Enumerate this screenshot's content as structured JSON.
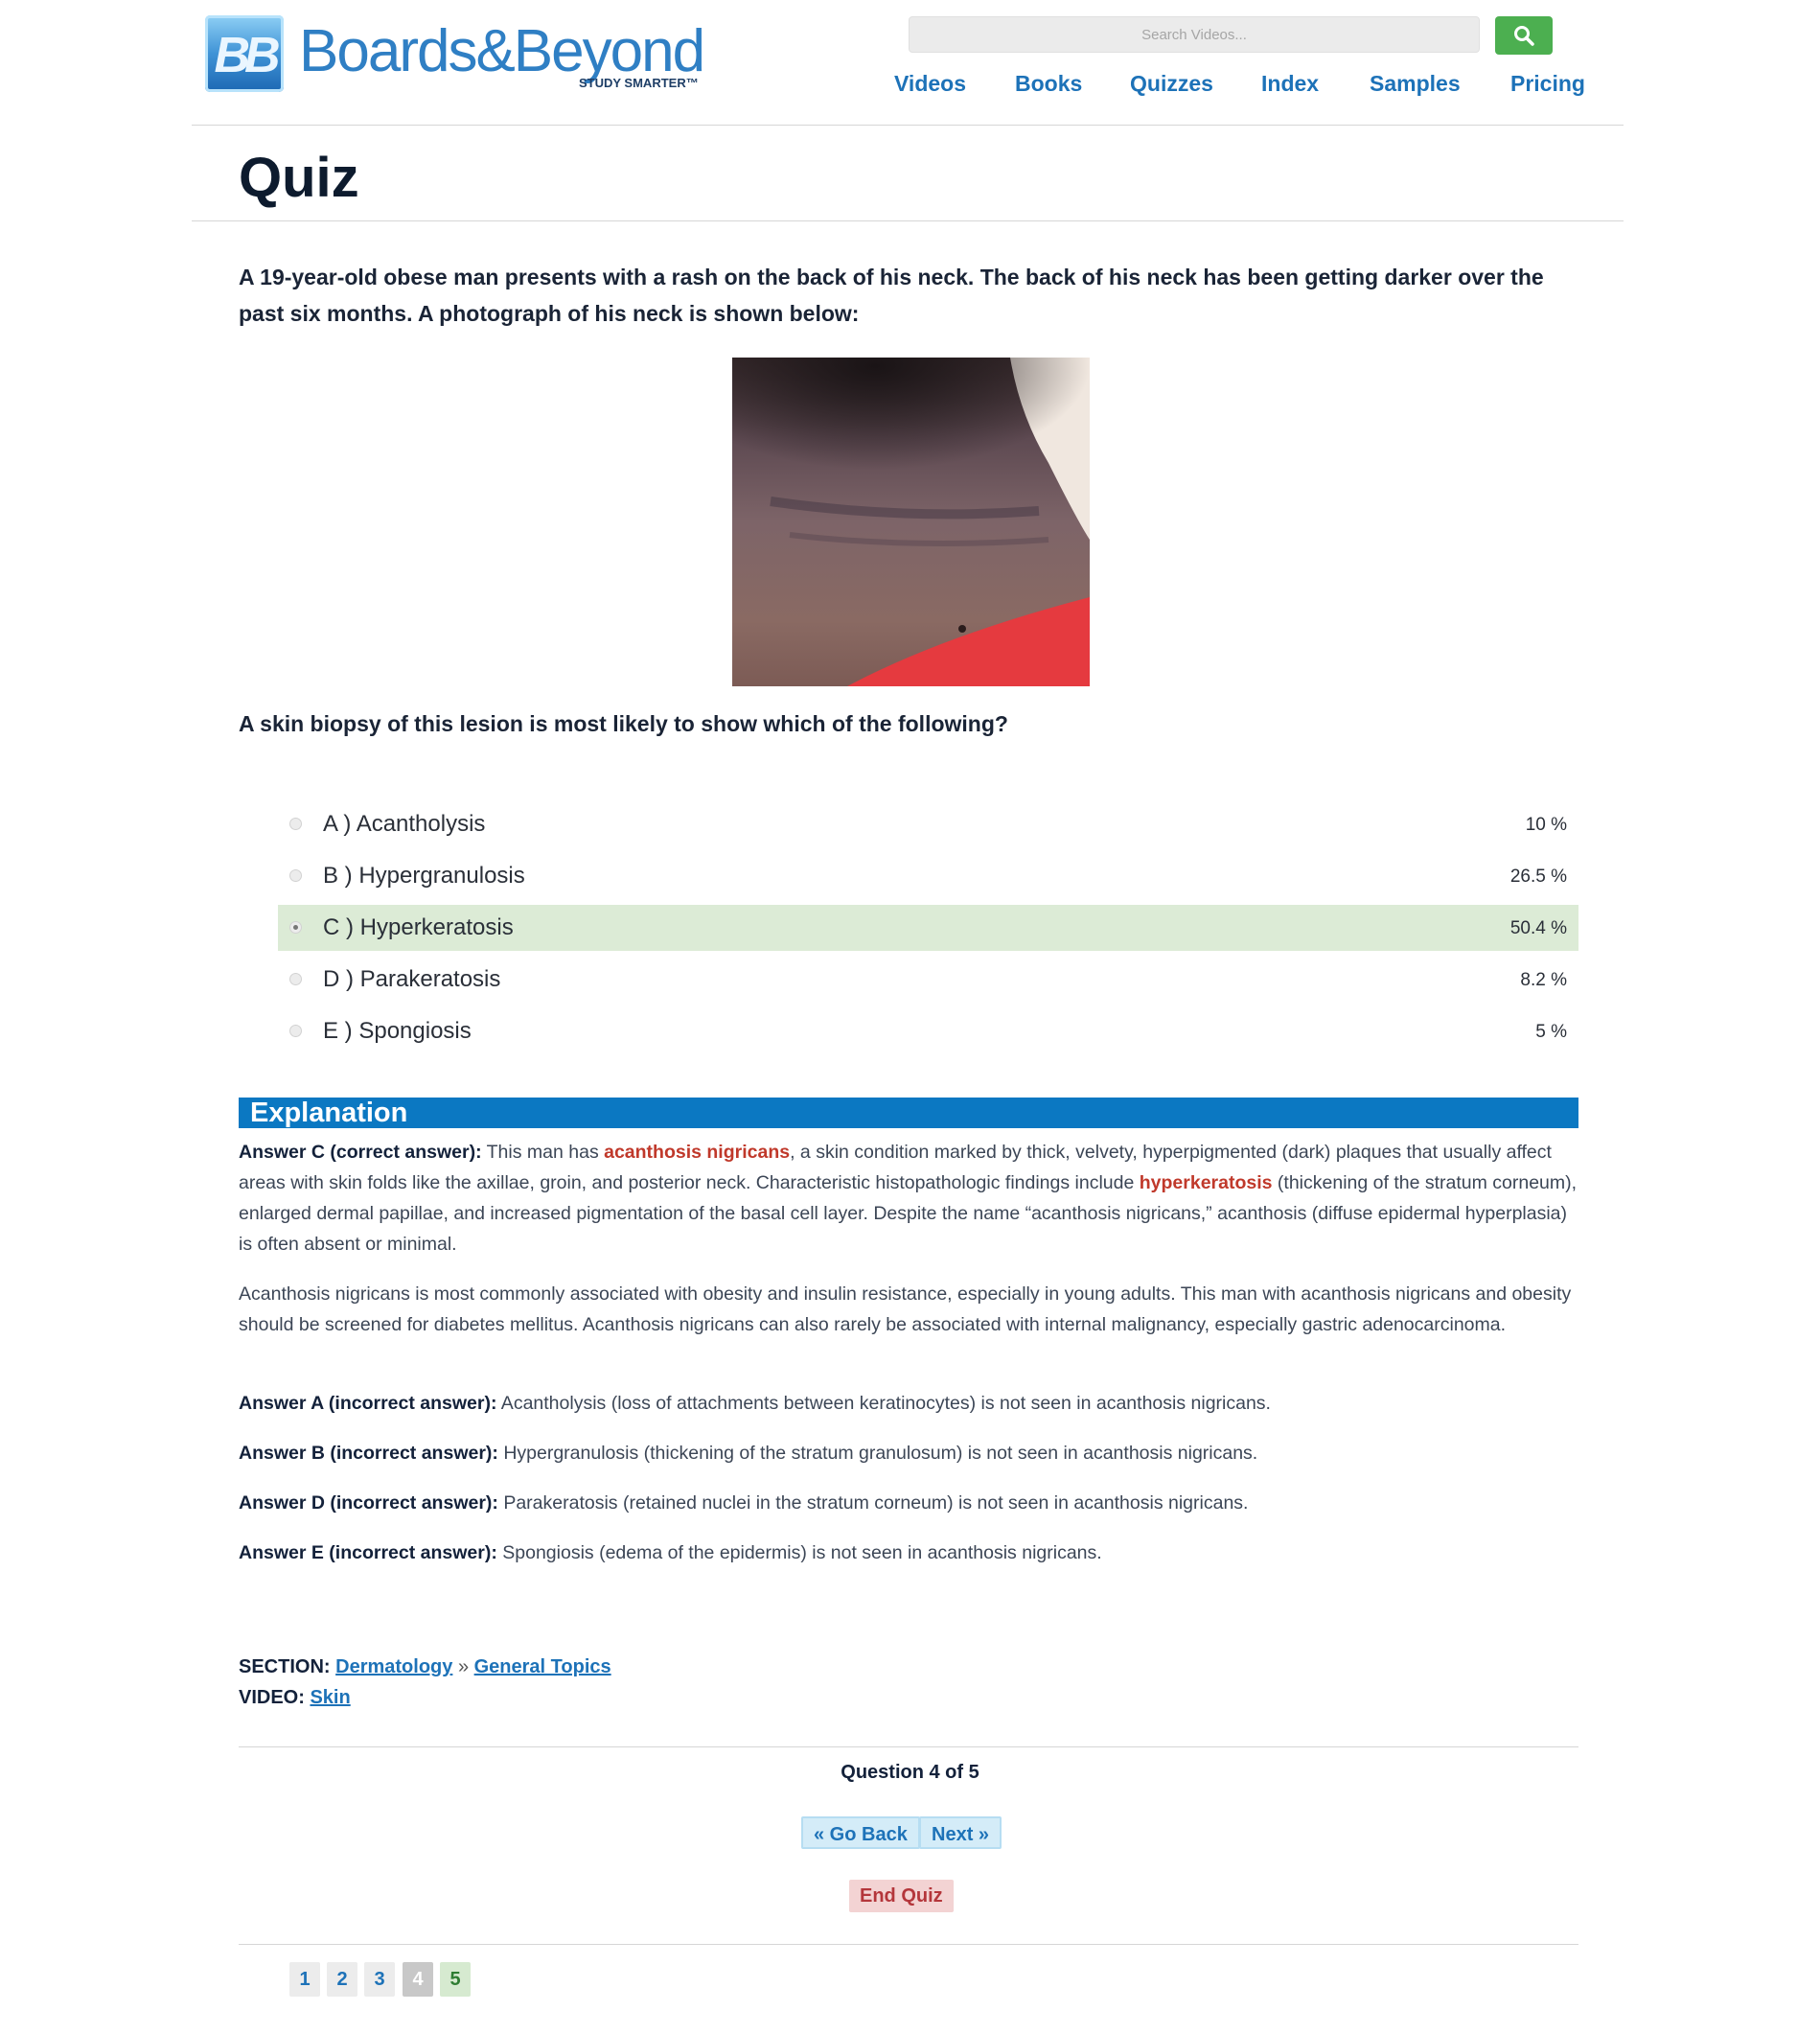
{
  "header": {
    "logo_text": "Boards&Beyond",
    "logo_mark": "BB",
    "logo_tagline": "STUDY SMARTER™",
    "search_placeholder": "Search Videos...",
    "search_icon": "magnifier-icon",
    "nav": [
      "Videos",
      "Books",
      "Quizzes",
      "Index",
      "Samples",
      "Pricing"
    ]
  },
  "page_title": "Quiz",
  "question": {
    "stem": "A 19-year-old obese man presents with a rash on the back of his neck. The back of his neck has been getting darker over the past six months. A photograph of his neck is shown below:",
    "prompt": "A skin biopsy of this lesion is most likely to show which of the following?",
    "choices": [
      {
        "label": "A ) Acantholysis",
        "pct": "10 %",
        "selected": false
      },
      {
        "label": "B ) Hypergranulosis",
        "pct": "26.5 %",
        "selected": false
      },
      {
        "label": "C ) Hyperkeratosis",
        "pct": "50.4 %",
        "selected": true
      },
      {
        "label": "D ) Parakeratosis",
        "pct": "8.2 %",
        "selected": false
      },
      {
        "label": "E ) Spongiosis",
        "pct": "5 %",
        "selected": false
      }
    ]
  },
  "explanation": {
    "heading": "Explanation",
    "p1": {
      "lead": "Answer C (correct answer):",
      "t1": " This man has ",
      "h1": "acanthosis nigricans",
      "t2": ", a skin condition marked by thick, velvety, hyperpigmented (dark) plaques that usually affect areas with skin folds like the axillae, groin, and posterior neck. Characteristic histopathologic findings include ",
      "h2": "hyperkeratosis",
      "t3": " (thickening of the stratum corneum), enlarged dermal papillae, and increased pigmentation of the basal cell layer. Despite the name “acanthosis nigricans,” acanthosis (diffuse epidermal hyperplasia) is often absent or minimal."
    },
    "p2": "Acanthosis nigricans is most commonly associated with obesity and insulin resistance, especially in young adults. This man with acanthosis nigricans and obesity should be screened for diabetes mellitus. Acanthosis nigricans can also rarely be associated with internal malignancy, especially gastric adenocarcinoma.",
    "pA": {
      "lead": "Answer A (incorrect answer):",
      "text": " Acantholysis (loss of attachments between keratinocytes) is not seen in acanthosis nigricans."
    },
    "pB": {
      "lead": "Answer B (incorrect answer):",
      "text": " Hypergranulosis (thickening of the stratum granulosum) is not seen in acanthosis nigricans."
    },
    "pD": {
      "lead": "Answer D (incorrect answer):",
      "text": " Parakeratosis (retained nuclei in the stratum corneum) is not seen in acanthosis nigricans."
    },
    "pE": {
      "lead": "Answer E (incorrect answer):",
      "text": " Spongiosis (edema of the epidermis) is not seen in acanthosis nigricans."
    }
  },
  "meta": {
    "section_label": "SECTION:",
    "section_link1": "Dermatology",
    "separator": "»",
    "section_link2": "General Topics",
    "video_label": "VIDEO:",
    "video_link": "Skin"
  },
  "footer": {
    "question_count": "Question 4 of 5",
    "go_back": "« Go Back",
    "next": "Next »",
    "end_quiz": "End Quiz",
    "pages": [
      "1",
      "2",
      "3",
      "4",
      "5"
    ]
  },
  "colors": {
    "brand_blue": "#1d72b8",
    "explanation_bar": "#0b78c2",
    "search_green": "#4caf50",
    "selected_row": "#dcebd6",
    "highlight_red": "#c0392b"
  }
}
